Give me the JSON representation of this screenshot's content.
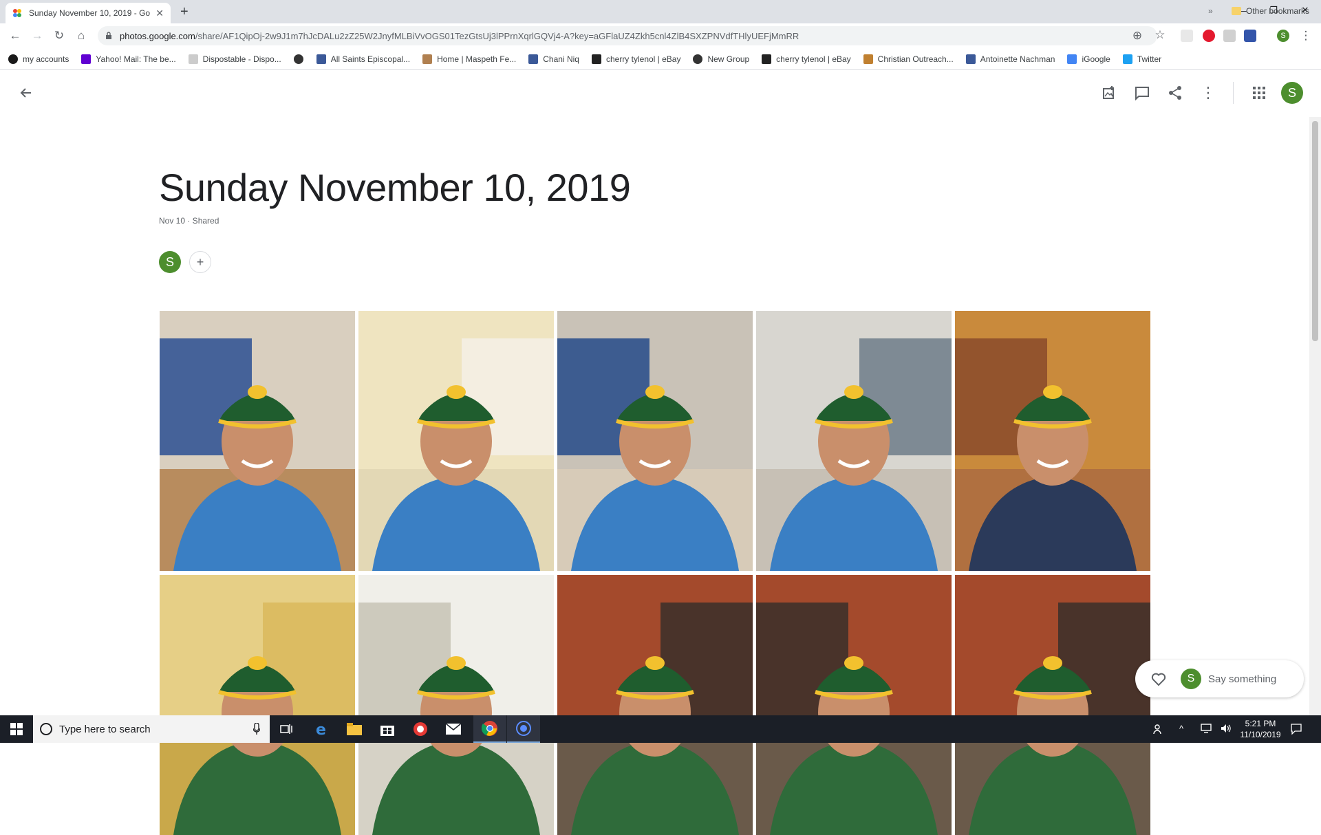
{
  "browser": {
    "tab_title": "Sunday November 10, 2019 - Go",
    "url_host": "photos.google.com",
    "url_path": "/share/AF1QipOj-2w9J1m7hJcDALu2zZ25W2JnyfMLBiVvOGS01TezGtsUj3lPPrnXqrlGQVj4-A?key=aGFlaUZ4Zkh5cnl4ZlB4SXZPNVdfTHlyUEFjMmRR",
    "profile_initial": "S",
    "bookmarks": [
      {
        "label": "my accounts",
        "icon": "globe-icon",
        "color": "#1a1a1a"
      },
      {
        "label": "Yahoo! Mail: The be...",
        "icon": "yahoo-icon",
        "color": "#6001d2"
      },
      {
        "label": "Dispostable - Dispo...",
        "icon": "page-icon",
        "color": "#cccccc"
      },
      {
        "label": "",
        "icon": "globe-icon",
        "color": "#333333"
      },
      {
        "label": "All Saints Episcopal...",
        "icon": "facebook-icon",
        "color": "#3b5998"
      },
      {
        "label": "Home | Maspeth Fe...",
        "icon": "page-icon",
        "color": "#b08050"
      },
      {
        "label": "Chani Niq",
        "icon": "facebook-icon",
        "color": "#3b5998"
      },
      {
        "label": "cherry tylenol | eBay",
        "icon": "bag-icon",
        "color": "#222222"
      },
      {
        "label": "New Group",
        "icon": "globe-icon",
        "color": "#333333"
      },
      {
        "label": "cherry tylenol | eBay",
        "icon": "bag-icon",
        "color": "#222222"
      },
      {
        "label": "Christian Outreach...",
        "icon": "page-icon",
        "color": "#c08030"
      },
      {
        "label": "Antoinette Nachman",
        "icon": "facebook-icon",
        "color": "#3b5998"
      },
      {
        "label": "iGoogle",
        "icon": "google-icon",
        "color": "#4285f4"
      },
      {
        "label": "Twitter",
        "icon": "twitter-icon",
        "color": "#1da1f2"
      }
    ],
    "bookmarks_more": "»",
    "other_bookmarks": "Other bookmarks"
  },
  "album": {
    "title": "Sunday November 10, 2019",
    "meta": "Nov 10 · Shared",
    "owner_initial": "S",
    "comment_placeholder": "Say something"
  },
  "photos": [
    {
      "scene": "diner",
      "shirt": "#3a7fc4"
    },
    {
      "scene": "bright",
      "shirt": "#3a7fc4"
    },
    {
      "scene": "diner-dark",
      "shirt": "#3a7fc4"
    },
    {
      "scene": "counter",
      "shirt": "#3a7fc4"
    },
    {
      "scene": "hallway",
      "shirt": "#2b3a5a"
    },
    {
      "scene": "yellow-wall",
      "shirt": "#2f6b3a"
    },
    {
      "scene": "door",
      "shirt": "#2f6b3a"
    },
    {
      "scene": "shop",
      "shirt": "#2f6b3a"
    },
    {
      "scene": "shop",
      "shirt": "#2f6b3a"
    },
    {
      "scene": "shop",
      "shirt": "#2f6b3a"
    }
  ],
  "taskbar": {
    "search_placeholder": "Type here to search",
    "time": "5:21 PM",
    "date": "11/10/2019"
  },
  "colors": {
    "accent_green": "#4d8e2e",
    "cap_green": "#1f5d2e",
    "cap_yellow": "#f2c12e"
  }
}
